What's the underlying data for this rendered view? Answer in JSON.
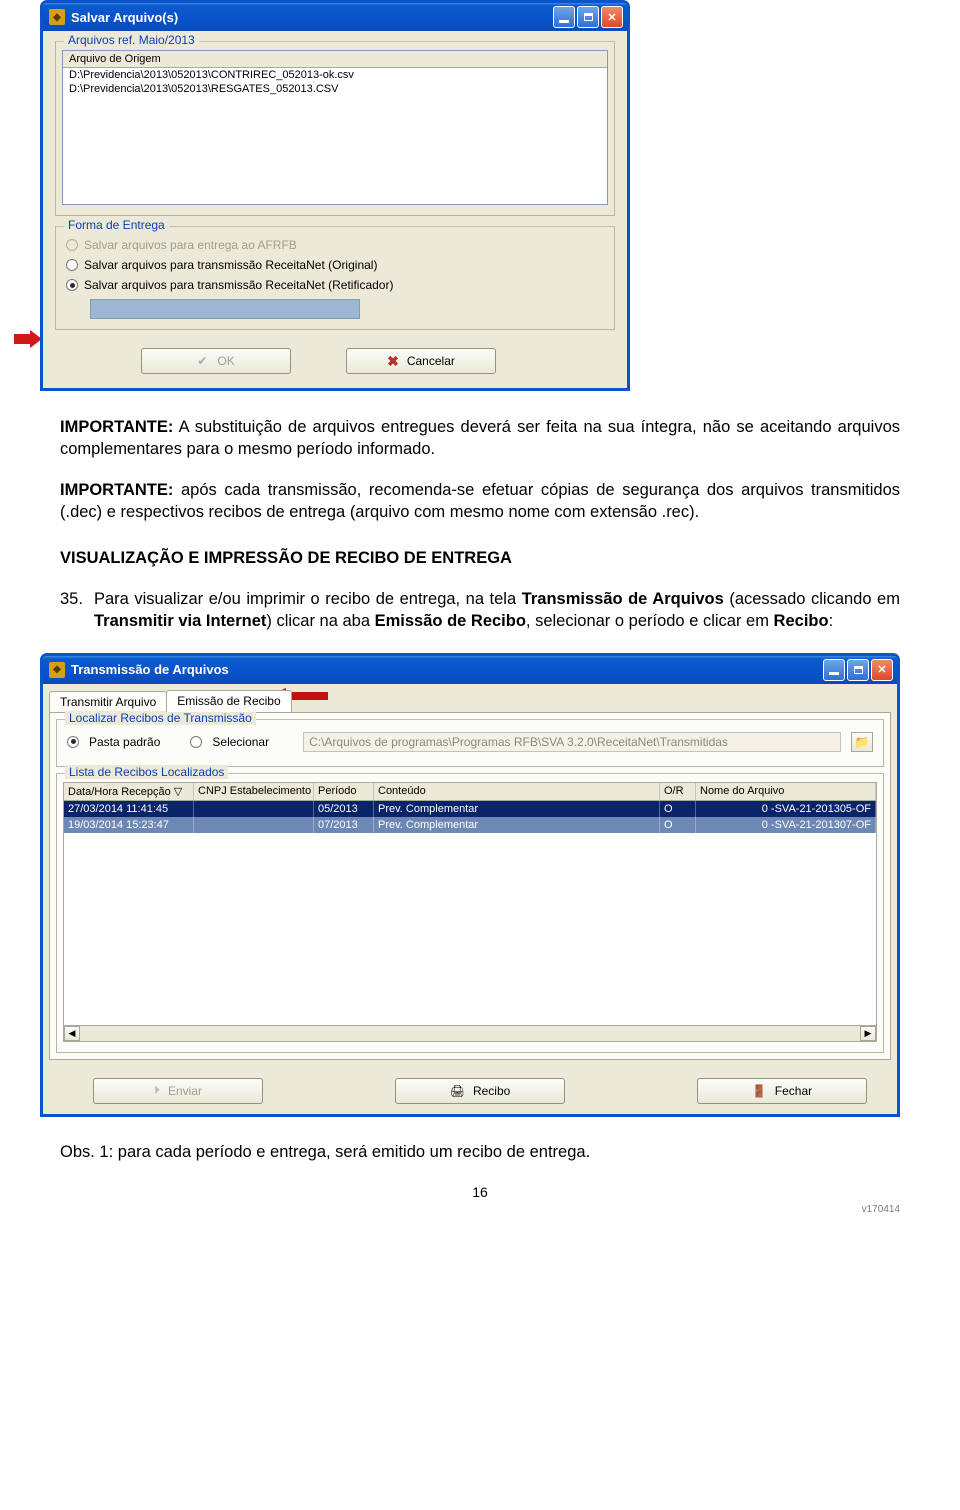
{
  "dialog1": {
    "title": "Salvar Arquivo(s)",
    "fieldset1_legend": "Arquivos ref. Maio/2013",
    "list_header": "Arquivo de Origem",
    "list_rows": [
      "D:\\Previdencia\\2013\\052013\\CONTRIREC_052013-ok.csv",
      "D:\\Previdencia\\2013\\052013\\RESGATES_052013.CSV"
    ],
    "fieldset2_legend": "Forma de Entrega",
    "radio1": "Salvar arquivos para entrega ao AFRFB",
    "radio2": "Salvar arquivos para transmissão ReceitaNet (Original)",
    "radio3": "Salvar arquivos para transmissão ReceitaNet (Retificador)",
    "ok_label": "OK",
    "cancel_label": "Cancelar"
  },
  "para1_bold": "IMPORTANTE:",
  "para1_rest": " A substituição de arquivos entregues deverá ser feita na sua íntegra, não se aceitando arquivos complementares para o mesmo período informado.",
  "para2_bold": "IMPORTANTE:",
  "para2_rest": " após cada transmissão, recomenda-se efetuar cópias de segurança dos arquivos transmitidos (.dec) e respectivos recibos de entrega (arquivo com mesmo nome com extensão .rec).",
  "heading": "VISUALIZAÇÃO E IMPRESSÃO DE RECIBO DE ENTREGA",
  "item35_num": "35.",
  "item35_a": "Para visualizar e/ou imprimir o recibo de entrega, na tela ",
  "item35_b1": "Transmissão de Arquivos",
  "item35_c": " (acessado clicando em ",
  "item35_b2": "Transmitir via Internet",
  "item35_d": ") clicar na aba ",
  "item35_b3": "Emissão de Recibo",
  "item35_e": ", selecionar o período e clicar em ",
  "item35_b4": "Recibo",
  "item35_f": ":",
  "dialog2": {
    "title": "Transmissão de Arquivos",
    "tab1": "Transmitir Arquivo",
    "tab2": "Emissão de Recibo",
    "fs1_legend": "Localizar Recibos de Transmissão",
    "radio_a": "Pasta padrão",
    "radio_b": "Selecionar",
    "path": "C:\\Arquivos de programas\\Programas RFB\\SVA 3.2.0\\ReceitaNet\\Transmitidas",
    "fs2_legend": "Lista de Recibos Localizados",
    "cols": [
      "Data/Hora Recepção ▽",
      "CNPJ Estabelecimento",
      "Período",
      "Conteúdo",
      "O/R",
      "Nome do Arquivo"
    ],
    "rows": [
      {
        "c": [
          "27/03/2014  11:41:45",
          "",
          "05/2013",
          "Prev. Complementar",
          "O",
          "0                    -SVA-21-201305-OF"
        ]
      },
      {
        "c": [
          "19/03/2014  15:23:47",
          "",
          "07/2013",
          "Prev. Complementar",
          "O",
          "0                    -SVA-21-201307-OF"
        ]
      }
    ],
    "btn_enviar": "Enviar",
    "btn_recibo": "Recibo",
    "btn_fechar": "Fechar"
  },
  "obs": "Obs. 1: para cada período e entrega, será emitido um recibo de entrega.",
  "pagenum": "16",
  "version": "v170414"
}
